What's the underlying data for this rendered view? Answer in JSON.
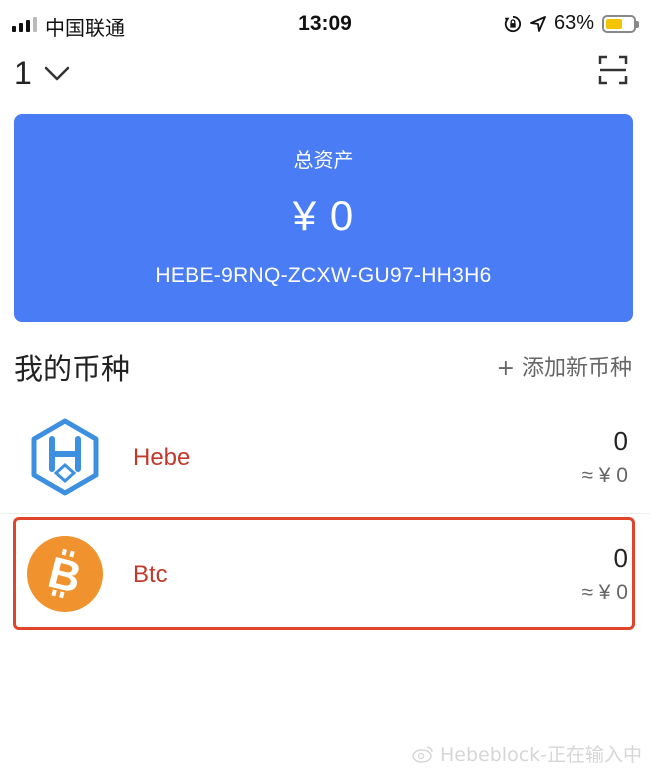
{
  "status_bar": {
    "carrier": "中国联通",
    "time": "13:09",
    "battery_percent": "63%",
    "battery_level": 0.63,
    "icons": [
      "signal-icon",
      "rotation-lock-icon",
      "location-arrow-icon",
      "battery-icon"
    ]
  },
  "header": {
    "wallet_name": "1",
    "icons": [
      "chevron-down-icon",
      "scan-icon"
    ]
  },
  "asset_card": {
    "label": "总资产",
    "value": "¥ 0",
    "address": "HEBE-9RNQ-ZCXW-GU97-HH3H6",
    "color": "#4a7cf6"
  },
  "coins_section": {
    "title": "我的币种",
    "add_label": "+ 添加新币种"
  },
  "coins": [
    {
      "name": "Hebe",
      "amount": "0",
      "fiat": "≈ ¥ 0",
      "icon": "hebe-logo-icon"
    },
    {
      "name": "Btc",
      "amount": "0",
      "fiat": "≈ ¥ 0",
      "icon": "bitcoin-icon"
    }
  ],
  "colors": {
    "coin_name": "#c0392b",
    "highlight_border": "#e0452a",
    "bitcoin_orange": "#f0922e"
  },
  "watermark": "Hebeblock-正在输入中"
}
